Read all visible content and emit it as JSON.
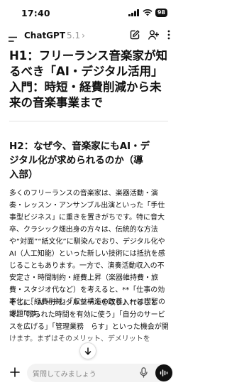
{
  "status_bar": {
    "time": "17:40",
    "battery": "98"
  },
  "nav": {
    "title": "ChatGPT",
    "version": "5.1",
    "version_arrow": "›"
  },
  "content": {
    "h1": "H1：フリーランス音楽家が知るべき「AI・デジタル活用」入門：時短・経費削減から未来の音楽事業まで",
    "h2": "H2：なぜ今、音楽家にもAI・デジタル化が求められるのか（導入部）",
    "paragraph1": "多くのフリーランスの音楽家は、楽器活動・演奏・レッスン・アンサンブル出演といった「手仕事型ビジネス」に重きを置きがちです。特に音大卒、クラシック畑出身の方々は、伝統的な方法や“対面”“紙文化”に馴染んでおり、デジタル化やAI（人工知能）といった新しい技術には抵抗を感じることもあります。一方で、演奏活動収入の不安定さ・時間制約・経費上昇（楽器維持費・旅費・スタジオ代など）を考えると、**「仕事の効率化」「経費削減」「収益構造の改善」**は喫緊の課題です。",
    "paragraph2": "そこに、AI・デジタルツールを取り入れることで、「限られた時間を有効に使う」「自分のサービスを広げる」「管理業務　らす」といった機会が開けます。まずはそのメリット、デメリットを"
  },
  "composer": {
    "placeholder": "質問してみましょう"
  },
  "icons": {
    "menu": "menu-icon",
    "edit": "edit-icon",
    "add_person": "add-person-icon",
    "more": "more-icon",
    "plus": "plus-icon",
    "mic": "mic-icon",
    "voice": "voice-wave-icon",
    "scroll_down": "arrow-down-icon",
    "signal": "signal-icon",
    "wifi": "wifi-icon",
    "battery": "battery-icon"
  }
}
